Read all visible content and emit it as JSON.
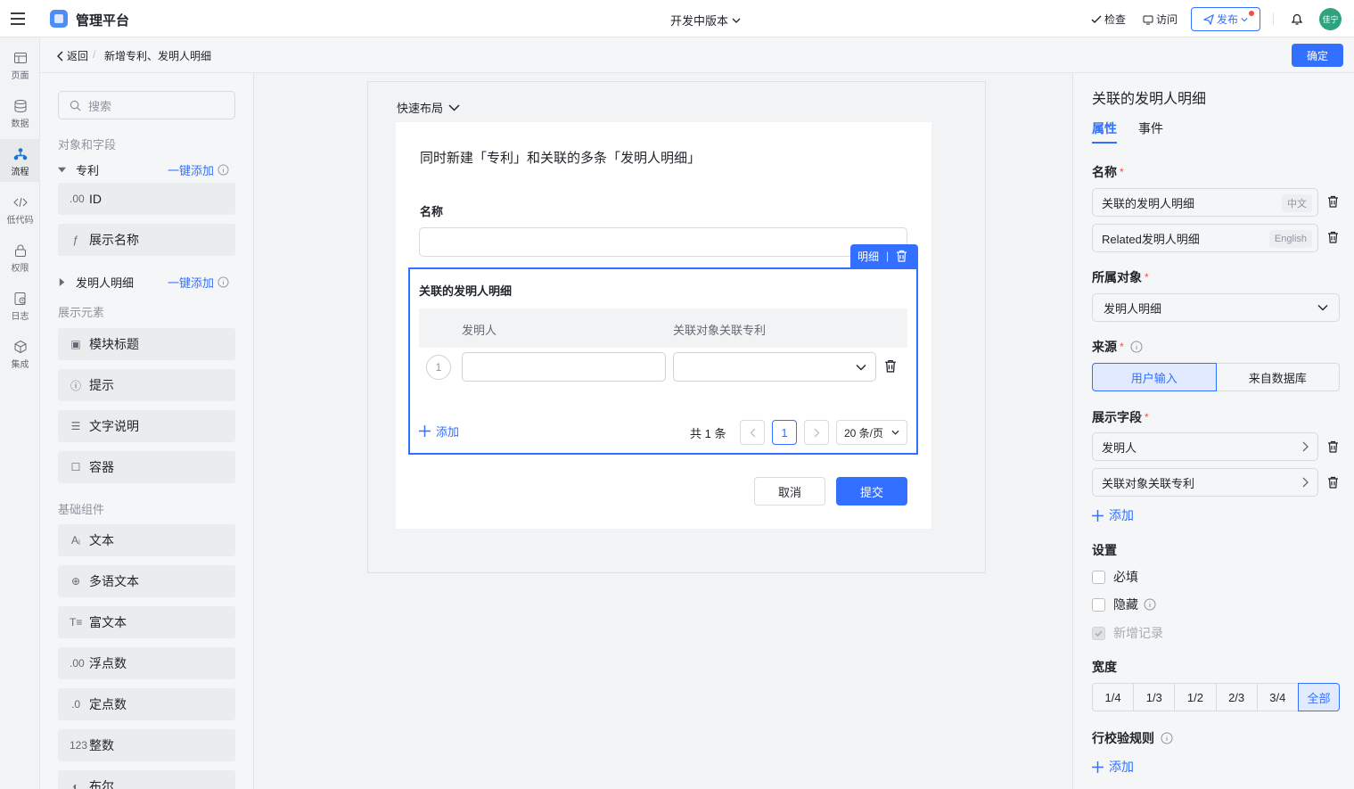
{
  "header": {
    "app_title": "管理平台",
    "version": "开发中版本",
    "check": "检查",
    "visit": "访问",
    "publish": "发布",
    "avatar_text": "佳宁",
    "avatar_color": "#2ea37d"
  },
  "rail": [
    {
      "label": "页面",
      "icon": "page-icon"
    },
    {
      "label": "数据",
      "icon": "database-icon"
    },
    {
      "label": "流程",
      "icon": "flow-icon"
    },
    {
      "label": "低代码",
      "icon": "code-icon"
    },
    {
      "label": "权限",
      "icon": "lock-icon"
    },
    {
      "label": "日志",
      "icon": "log-icon"
    },
    {
      "label": "集成",
      "icon": "cube-icon"
    }
  ],
  "subbar": {
    "back": "返回",
    "separator": "/",
    "title": "新增专利、发明人明细",
    "confirm": "确定"
  },
  "left_panel": {
    "search_placeholder": "搜索",
    "section_objects": "对象和字段",
    "group1": {
      "name": "专利",
      "one_click": "一键添加"
    },
    "group1_items": [
      {
        "icon": ".00",
        "label": "ID"
      },
      {
        "icon": "ƒ",
        "label": "展示名称"
      }
    ],
    "group2": {
      "name": "发明人明细",
      "one_click": "一键添加"
    },
    "section_display": "展示元素",
    "display_items": [
      {
        "icon": "▣",
        "label": "模块标题"
      },
      {
        "icon": "ⓘ",
        "label": "提示"
      },
      {
        "icon": "☰",
        "label": "文字说明"
      },
      {
        "icon": "☐",
        "label": "容器"
      }
    ],
    "section_basic": "基础组件",
    "basic_items": [
      {
        "icon": "Aᵢ",
        "label": "文本"
      },
      {
        "icon": "⊕",
        "label": "多语文本"
      },
      {
        "icon": "T≡",
        "label": "富文本"
      },
      {
        "icon": ".00",
        "label": "浮点数"
      },
      {
        "icon": ".0",
        "label": "定点数"
      },
      {
        "icon": "123",
        "label": "整数"
      },
      {
        "icon": "◐",
        "label": "布尔"
      }
    ]
  },
  "modal": {
    "quick_layout": "快速布局",
    "form_title": "同时新建「专利」和关联的多条「发明人明细」",
    "name_label": "名称",
    "detail_tag": "明细",
    "detail_tag_sep": "|",
    "detail_title": "关联的发明人明细",
    "columns": [
      "发明人",
      "关联对象关联专利"
    ],
    "row_number": "1",
    "add": "添加",
    "total": "共 1 条",
    "current_page": "1",
    "page_size": "20 条/页",
    "cancel": "取消",
    "submit": "提交"
  },
  "right_panel": {
    "title": "关联的发明人明细",
    "tabs": [
      "属性",
      "事件"
    ],
    "name_label": "名称",
    "required_mark": "*",
    "name_zh": "关联的发明人明细",
    "name_zh_tag": "中文",
    "name_en": "Related发明人明细",
    "name_en_tag": "English",
    "object_label": "所属对象",
    "object_value": "发明人明细",
    "source_label": "来源",
    "source_options": [
      "用户输入",
      "来自数据库"
    ],
    "fields_label": "展示字段",
    "fields": [
      "发明人",
      "关联对象关联专利"
    ],
    "add": "添加",
    "settings_label": "设置",
    "settings": [
      {
        "label": "必填"
      },
      {
        "label": "隐藏"
      },
      {
        "label": "新增记录"
      }
    ],
    "width_label": "宽度",
    "width_options": [
      "1/4",
      "1/3",
      "1/2",
      "2/3",
      "3/4",
      "全部"
    ],
    "row_rule_label": "行校验规则",
    "row_rule_add": "添加"
  },
  "colors": {
    "accent": "#3370ff",
    "danger": "#f54a45"
  }
}
